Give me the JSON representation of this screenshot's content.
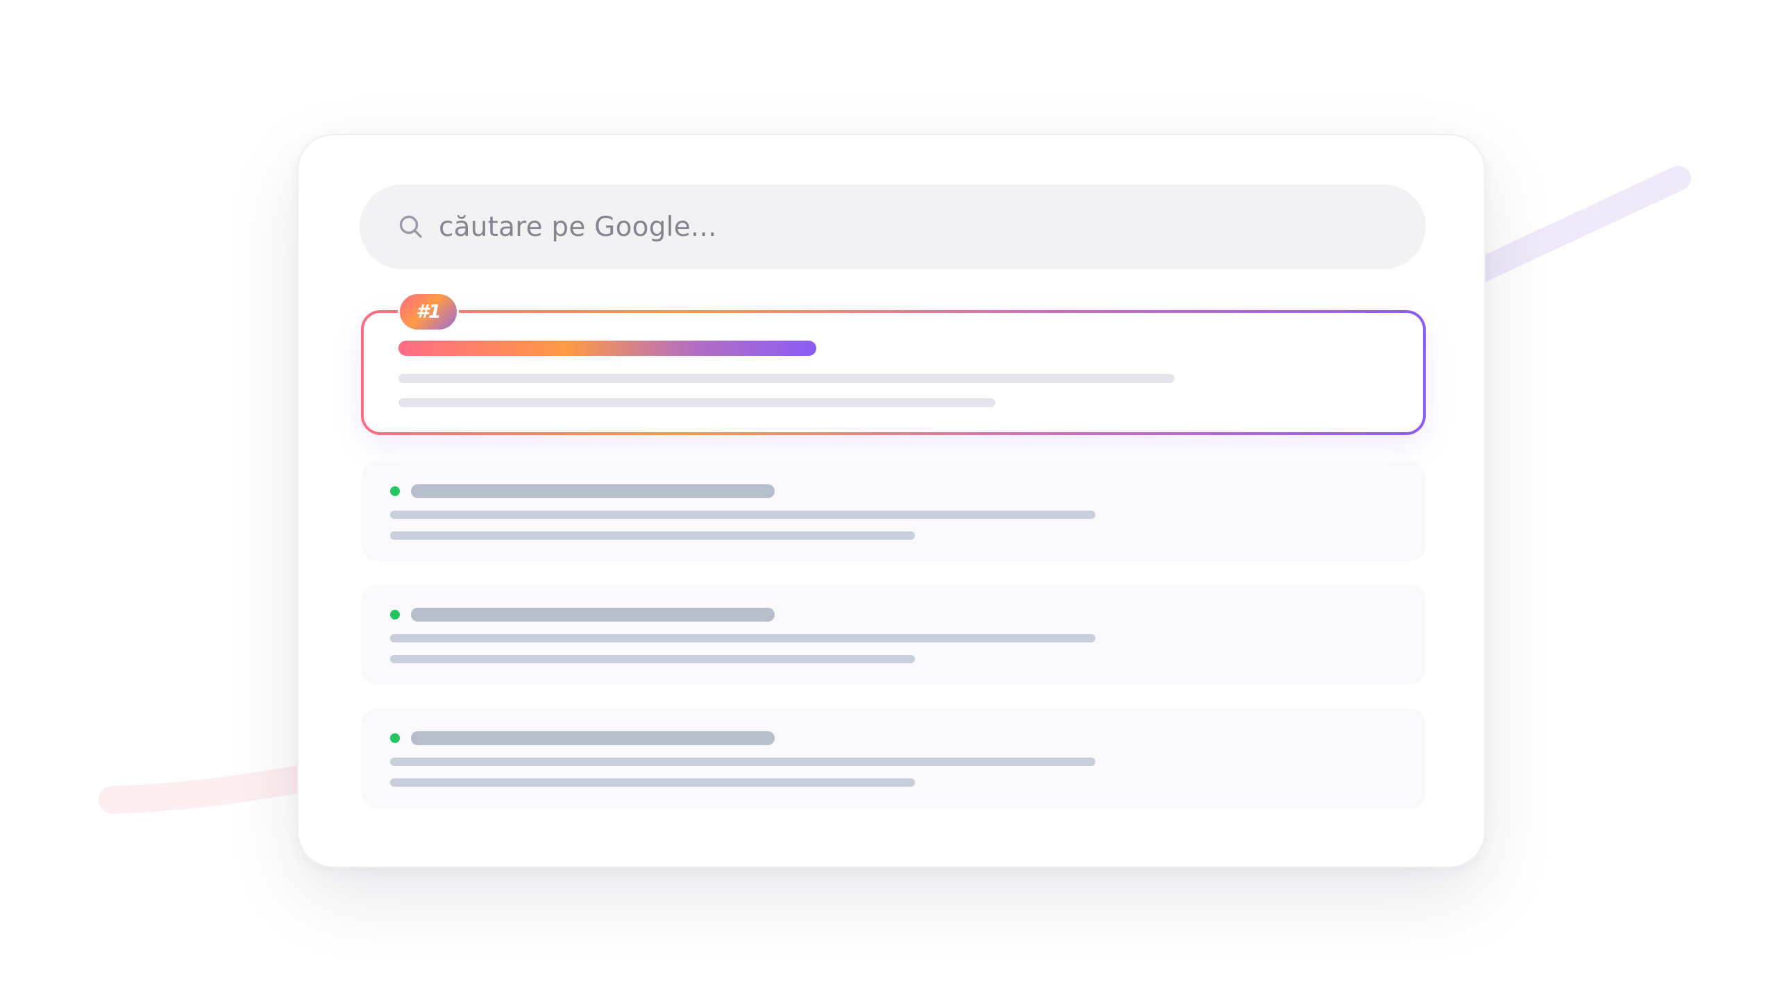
{
  "search": {
    "placeholder": "căutare pe Google...",
    "icon": "search-icon"
  },
  "top_result": {
    "badge": "#1",
    "gradient_colors": [
      "#ff6b86",
      "#ff9a45",
      "#8b5cf6"
    ]
  },
  "results": [
    {
      "status_color": "#22c55e"
    },
    {
      "status_color": "#22c55e"
    },
    {
      "status_color": "#22c55e"
    }
  ]
}
